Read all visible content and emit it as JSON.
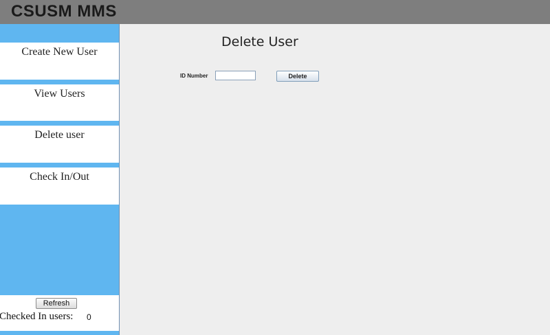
{
  "app": {
    "title": "CSUSM MMS"
  },
  "sidebar": {
    "items": [
      {
        "label": "Create New User"
      },
      {
        "label": "View Users"
      },
      {
        "label": "Delete user"
      },
      {
        "label": "Check In/Out"
      }
    ],
    "refresh_label": "Refresh",
    "checked_in_label": "Checked In users:",
    "checked_in_count": "0"
  },
  "main": {
    "title": "Delete User",
    "id_label": "ID Number",
    "id_value": "",
    "delete_label": "Delete"
  },
  "colors": {
    "titlebar": "#7e7e7e",
    "sidebar": "#5fb6f0",
    "content_bg": "#eeeeee"
  }
}
